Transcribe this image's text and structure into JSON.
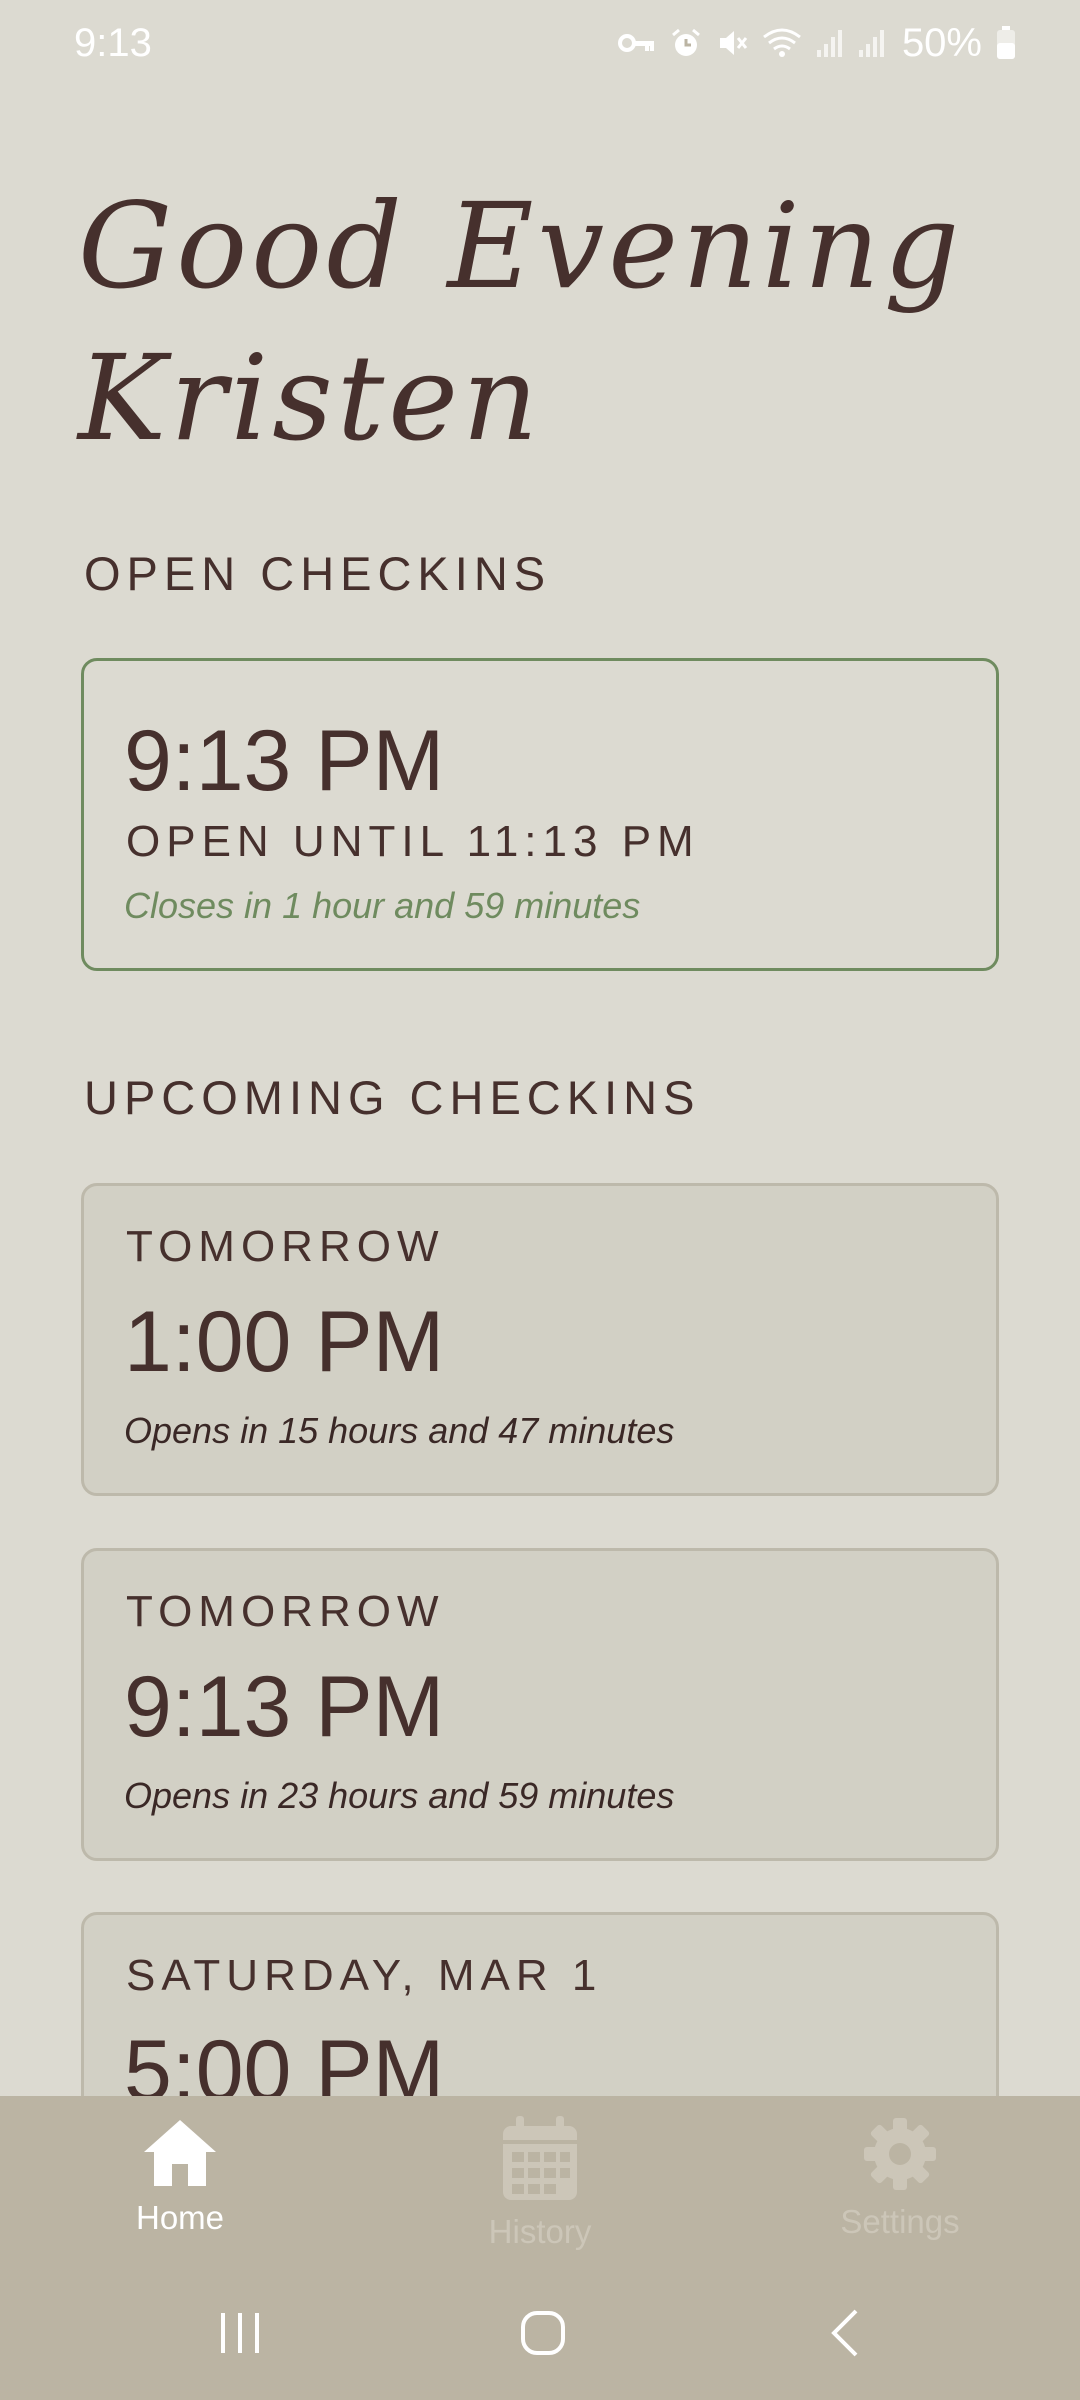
{
  "status_bar": {
    "time": "9:13",
    "battery_percent": "50%",
    "icons": [
      "vpn-key-icon",
      "alarm-icon",
      "mute-icon",
      "wifi-icon",
      "signal-icon",
      "signal-icon",
      "battery-icon"
    ]
  },
  "greeting": {
    "line1": "Good Evening",
    "line2": "Kristen"
  },
  "open_section": {
    "title": "OPEN CHECKINS",
    "cards": [
      {
        "time": "9:13 PM",
        "open_until": "OPEN UNTIL 11:13 PM",
        "note": "Closes in 1 hour and 59 minutes"
      }
    ]
  },
  "upcoming_section": {
    "title": "UPCOMING CHECKINS",
    "cards": [
      {
        "day": "TOMORROW",
        "time": "1:00 PM",
        "note": "Opens in 15 hours and 47 minutes"
      },
      {
        "day": "TOMORROW",
        "time": "9:13 PM",
        "note": "Opens in 23 hours and 59 minutes"
      },
      {
        "day": "SATURDAY, MAR 1",
        "time": "5:00 PM",
        "note": ""
      }
    ]
  },
  "bottom_nav": {
    "items": [
      {
        "label": "Home",
        "icon": "home-icon",
        "active": true
      },
      {
        "label": "History",
        "icon": "calendar-icon",
        "active": false
      },
      {
        "label": "Settings",
        "icon": "gear-icon",
        "active": false
      }
    ]
  },
  "system_nav": {
    "icons": [
      "recents-icon",
      "home-circle-icon",
      "back-icon"
    ]
  },
  "colors": {
    "background": "#dcdad1",
    "text": "#46302d",
    "open_accent": "#6f8b5f",
    "upcoming_card": "#d2d0c5",
    "nav_bar": "#bbb4a3"
  }
}
